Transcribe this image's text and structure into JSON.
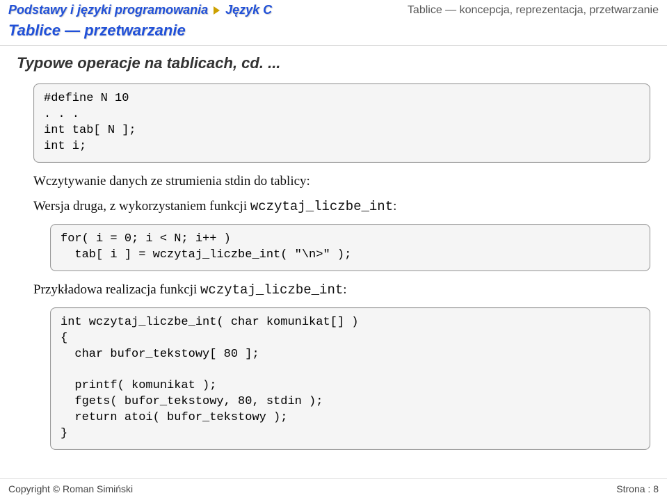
{
  "header": {
    "left": "Podstawy i języki programowania",
    "center": "Język C",
    "right": "Tablice — koncepcja, reprezentacja, przetwarzanie"
  },
  "subheader": "Tablice — przetwarzanie",
  "slide_title": "Typowe operacje na tablicach, cd. ...",
  "code1": "#define N 10\n. . .\nint tab[ N ];\nint i;",
  "text1_a": "Wczytywanie danych ze strumienia stdin do tablicy:",
  "text1_b_pre": "Wersja druga, z wykorzystaniem funkcji ",
  "text1_b_mono": "wczytaj_liczbe_int",
  "text1_b_post": ":",
  "code2": "for( i = 0; i < N; i++ )\n  tab[ i ] = wczytaj_liczbe_int( \"\\n>\" );",
  "text2_pre": "Przykładowa realizacja funkcji ",
  "text2_mono": "wczytaj_liczbe_int",
  "text2_post": ":",
  "code3": "int wczytaj_liczbe_int( char komunikat[] )\n{\n  char bufor_tekstowy[ 80 ];\n\n  printf( komunikat );\n  fgets( bufor_tekstowy, 80, stdin );\n  return atoi( bufor_tekstowy );\n}",
  "footer": {
    "left": "Copyright © Roman Simiński",
    "right": "Strona : 8"
  }
}
